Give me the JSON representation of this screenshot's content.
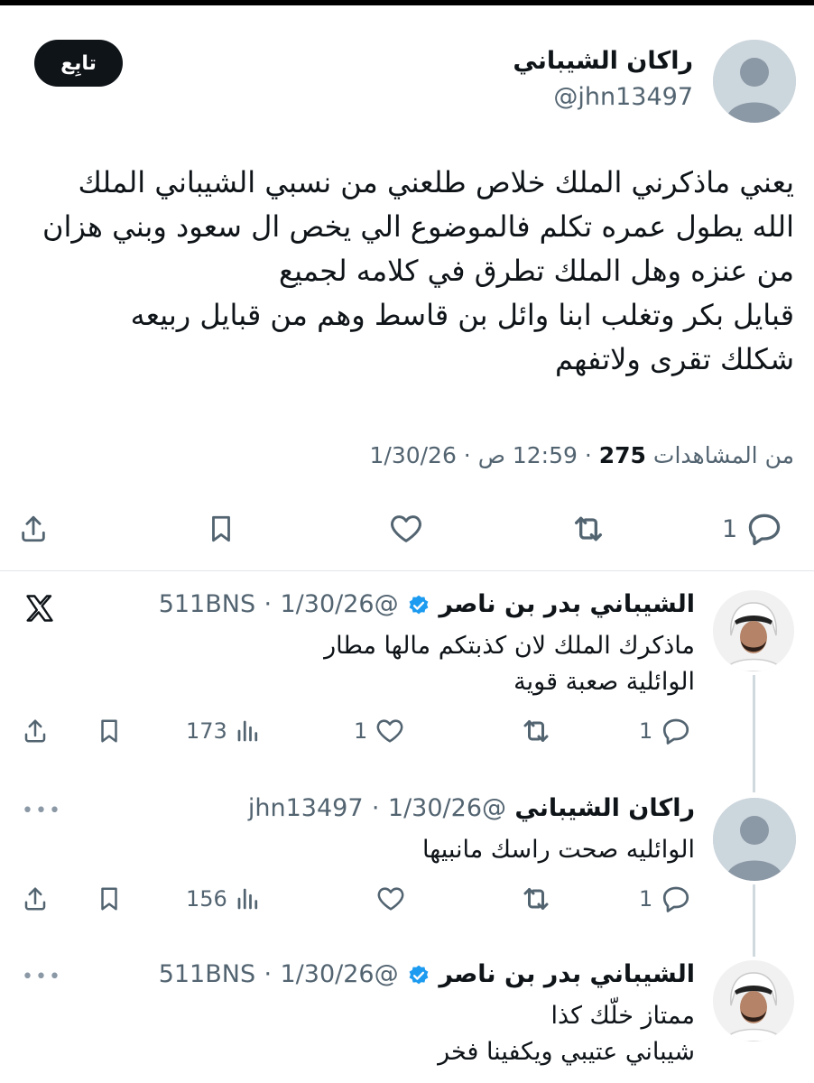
{
  "main_tweet": {
    "author_name": "راكان الشيباني",
    "handle": "@jhn13497",
    "follow_label": "تابِع",
    "lines": [
      "يعني ماذكرني الملك خلاص طلعني من نسبي الشيباني الملك",
      "الله يطول عمره تكلم فالموضوع الي يخص ال سعود وبني هزان",
      "من عنزه وهل الملك تطرق في كلامه لجميع",
      "قبايل بكر وتغلب ابنا وائل بن قاسط وهم من قبايل ربيعه",
      "شكلك تقرى ولاتفهم"
    ],
    "date": "1/30/26",
    "time": "12:59 ص",
    "views_count": "275",
    "views_label": "من المشاهدات",
    "reply_count": "1"
  },
  "replies": [
    {
      "author_name": "الشيباني بدر بن ناصر",
      "handle": "@511BNS",
      "date": "1/30/26",
      "verified": true,
      "lines": [
        "ماذكرك الملك لان كذبتكم مالها مطار",
        "الوائلية صعبة قوية"
      ],
      "reply_count": "1",
      "like_count": "1",
      "views_count": "173"
    },
    {
      "author_name": "راكان الشيباني",
      "handle": "@jhn13497",
      "date": "1/30/26",
      "verified": false,
      "lines": [
        "الوائليه صحت راسك مانبيها"
      ],
      "reply_count": "1",
      "like_count": "",
      "views_count": "156"
    },
    {
      "author_name": "الشيباني بدر بن ناصر",
      "handle": "@511BNS",
      "date": "1/30/26",
      "verified": true,
      "lines": [
        "ممتاز خلّك كذا",
        "شيباني عتيبي ويكفينا فخر"
      ]
    }
  ],
  "colors": {
    "text": "#0f1419",
    "secondary": "#536471",
    "verified": "#1d9bf0",
    "divider": "#e1e6ea"
  },
  "icons": [
    "share-icon",
    "bookmark-icon",
    "heart-icon",
    "retweet-icon",
    "reply-icon",
    "views-icon",
    "x-logo-icon",
    "more-icon",
    "verified-badge-icon"
  ]
}
